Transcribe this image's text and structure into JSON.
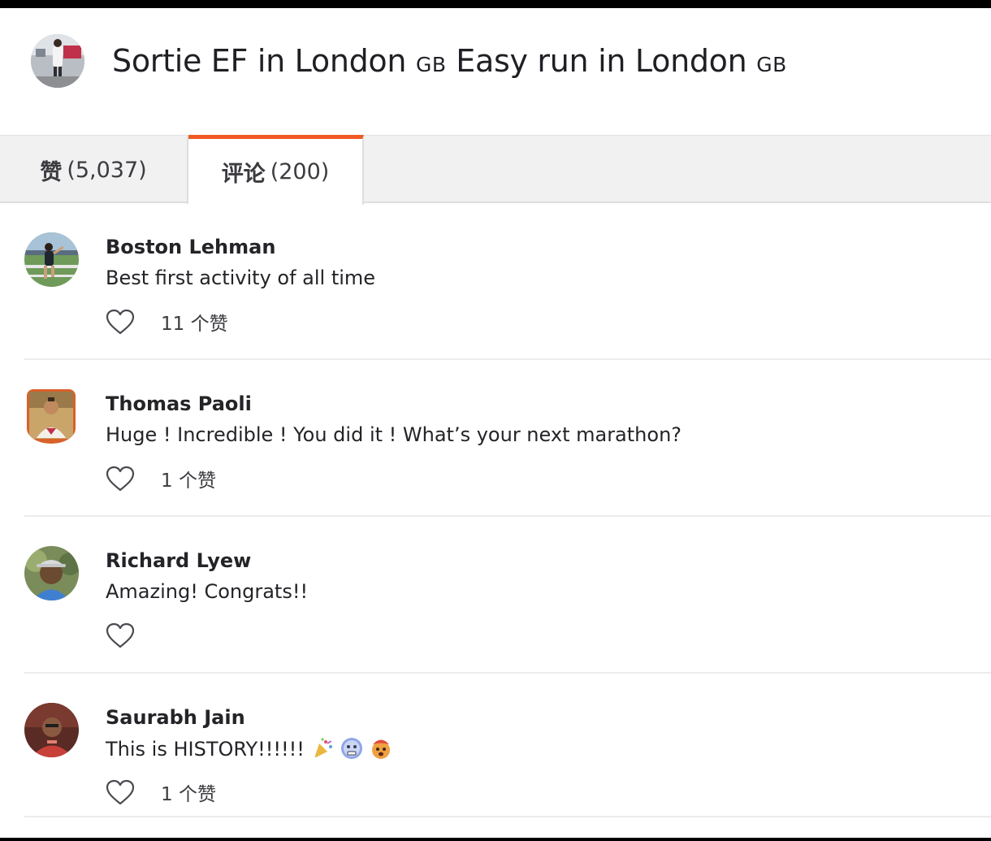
{
  "header": {
    "title_part1": "Sortie EF in London",
    "flag1": "GB",
    "title_part2": "Easy run in London",
    "flag2": "GB"
  },
  "tabs": [
    {
      "label": "赞",
      "count": "(5,037)",
      "active": false
    },
    {
      "label": "评论",
      "count": "(200)",
      "active": true
    }
  ],
  "colors": {
    "accent": "#f05a22"
  },
  "comments": [
    {
      "name": "Boston Lehman",
      "text": "Best first activity of all time",
      "likes": "11 个赞",
      "avatar": "runner-track-photo"
    },
    {
      "name": "Thomas Paoli",
      "text": "Huge ! Incredible ! You did it ! What’s your next marathon?",
      "likes": "1 个赞",
      "avatar": "shield-photo"
    },
    {
      "name": "Richard Lyew",
      "text": "Amazing! Congrats!!",
      "likes": "",
      "avatar": "cap-photo"
    },
    {
      "name": "Saurabh Jain",
      "text": "This is HISTORY!!!!!!",
      "likes": "1 个赞",
      "avatar": "portrait-photo",
      "emojis": [
        "party-popper-emoji",
        "cold-face-emoji",
        "exploding-head-emoji"
      ]
    }
  ]
}
